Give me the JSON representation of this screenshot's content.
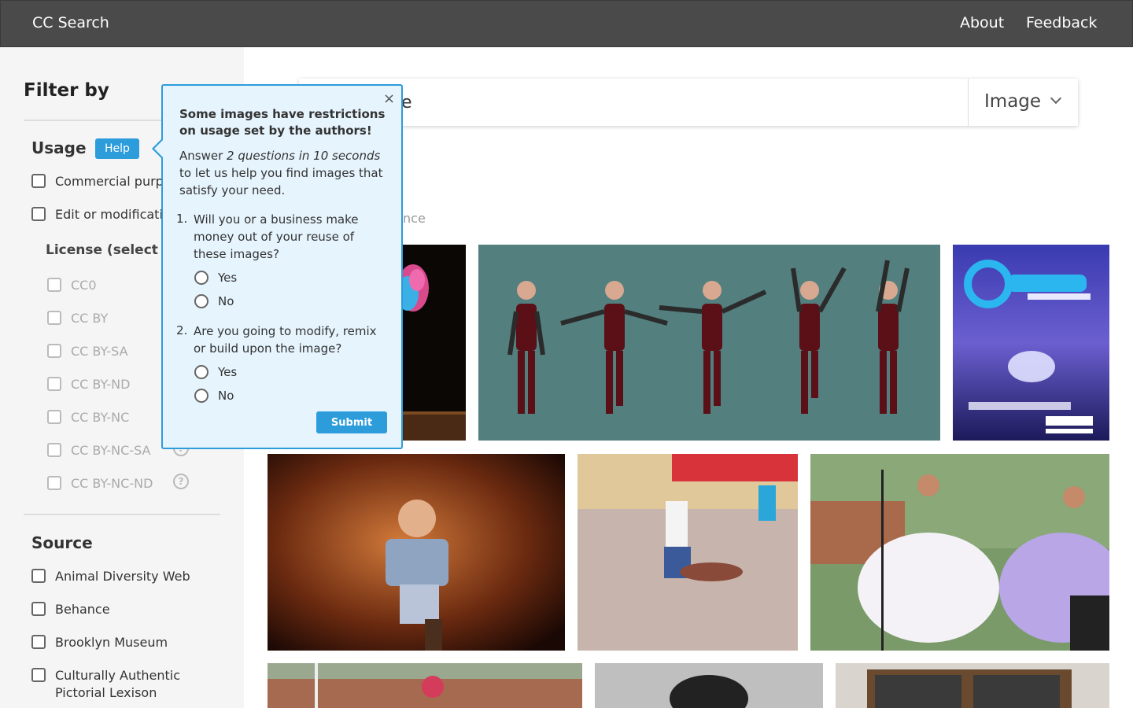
{
  "topbar": {
    "brand": "CC Search",
    "about": "About",
    "feedback": "Feedback"
  },
  "sidebar": {
    "title": "Filter by",
    "usage": {
      "title": "Usage",
      "help": "Help",
      "items": [
        "Commercial purpo",
        "Edit or modificatio"
      ]
    },
    "license": {
      "title": "License (select u",
      "items": [
        "CC0",
        "CC BY",
        "CC BY-SA",
        "CC BY-ND",
        "CC BY-NC",
        "CC BY-NC-SA",
        "CC BY-NC-ND"
      ]
    },
    "source": {
      "title": "Source",
      "items": [
        "Animal Diversity Web",
        "Behance",
        "Brooklyn Museum",
        "Culturally Authentic Pictorial Lexison"
      ]
    }
  },
  "search": {
    "value": "e",
    "type": "Image",
    "hint": "nce"
  },
  "popover": {
    "close": "×",
    "heading": "Some images have restrictions on usage set by the authors!",
    "intro_pre": "Answer ",
    "intro_em": "2 questions in 10 seconds",
    "intro_post": " to let us help you find images that satisfy your need.",
    "q1_num": "1.",
    "q1": "Will you or a business make money out of your reuse of these images?",
    "q2_num": "2.",
    "q2": "Are you going to modify, remix or build upon the image?",
    "yes": "Yes",
    "no": "No",
    "submit": "Submit"
  },
  "colors": {
    "topbar": "#4a4a4a",
    "accent": "#2d9cdb",
    "sidebar": "#f5f5f5",
    "popover_bg": "#e6f4fd"
  }
}
